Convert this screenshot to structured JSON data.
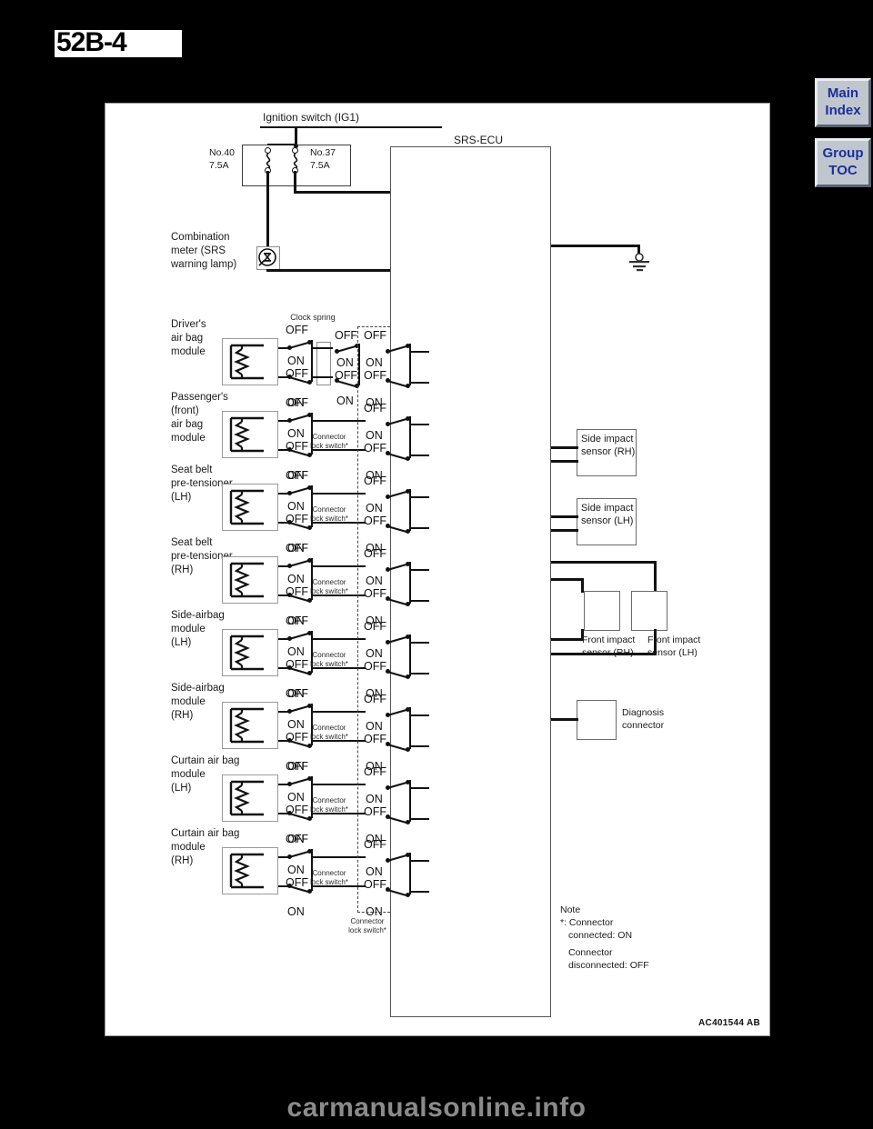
{
  "page": {
    "number": "52B-4",
    "watermark": "carmanualsonline.info"
  },
  "nav": {
    "main_index": "Main\nIndex",
    "main_index_line1": "Main",
    "main_index_line2": "Index",
    "group_toc_line1": "Group",
    "group_toc_line2": "TOC"
  },
  "diagram": {
    "figure_ref": "AC401544 AB",
    "ignition_switch": "Ignition switch (IG1)",
    "srs_ecu": "SRS-ECU",
    "clock_spring": "Clock spring",
    "fuses": [
      {
        "no": "No.40",
        "rating": "7.5A"
      },
      {
        "no": "No.37",
        "rating": "7.5A"
      }
    ],
    "combination_meter": "Combination\nmeter (SRS\nwarning lamp)",
    "connector_lock_switch": "Connector\nlock switch*",
    "modules": [
      {
        "label": "Driver's\nair bag\nmodule",
        "mid": "clock-spring"
      },
      {
        "label": "Passenger's\n(front)\nair bag\nmodule",
        "mid": "Connector\nlock switch*"
      },
      {
        "label": "Seat belt\npre-tensioner\n(LH)",
        "mid": "Connector\nlock switch*"
      },
      {
        "label": "Seat belt\npre-tensioner\n(RH)",
        "mid": "Connector\nlock switch*"
      },
      {
        "label": "Side-airbag\nmodule\n(LH)",
        "mid": "Connector\nlock switch*"
      },
      {
        "label": "Side-airbag\nmodule\n(RH)",
        "mid": "Connector\nlock switch*"
      },
      {
        "label": "Curtain air bag\nmodule\n(LH)",
        "mid": "Connector\nlock switch*"
      },
      {
        "label": "Curtain air bag\nmodule\n(RH)",
        "mid": "Connector\nlock switch*"
      }
    ],
    "switch_states": {
      "off": "OFF",
      "on": "ON"
    },
    "sensors": [
      {
        "name": "Side impact\nsensor (RH)"
      },
      {
        "name": "Side impact\nsensor (LH)"
      },
      {
        "name": "Front impact\nsensor (RH)"
      },
      {
        "name": "Front impact\nsensor (LH)"
      },
      {
        "name": "Diagnosis\nconnector"
      }
    ],
    "note": "Note\n*: Connector\n  connected: ON\n\n  Connector\n  disconnected: OFF",
    "note_title": "Note",
    "note_line1": "*: Connector",
    "note_line2": "connected: ON",
    "note_line3": "Connector",
    "note_line4": "disconnected: OFF"
  }
}
